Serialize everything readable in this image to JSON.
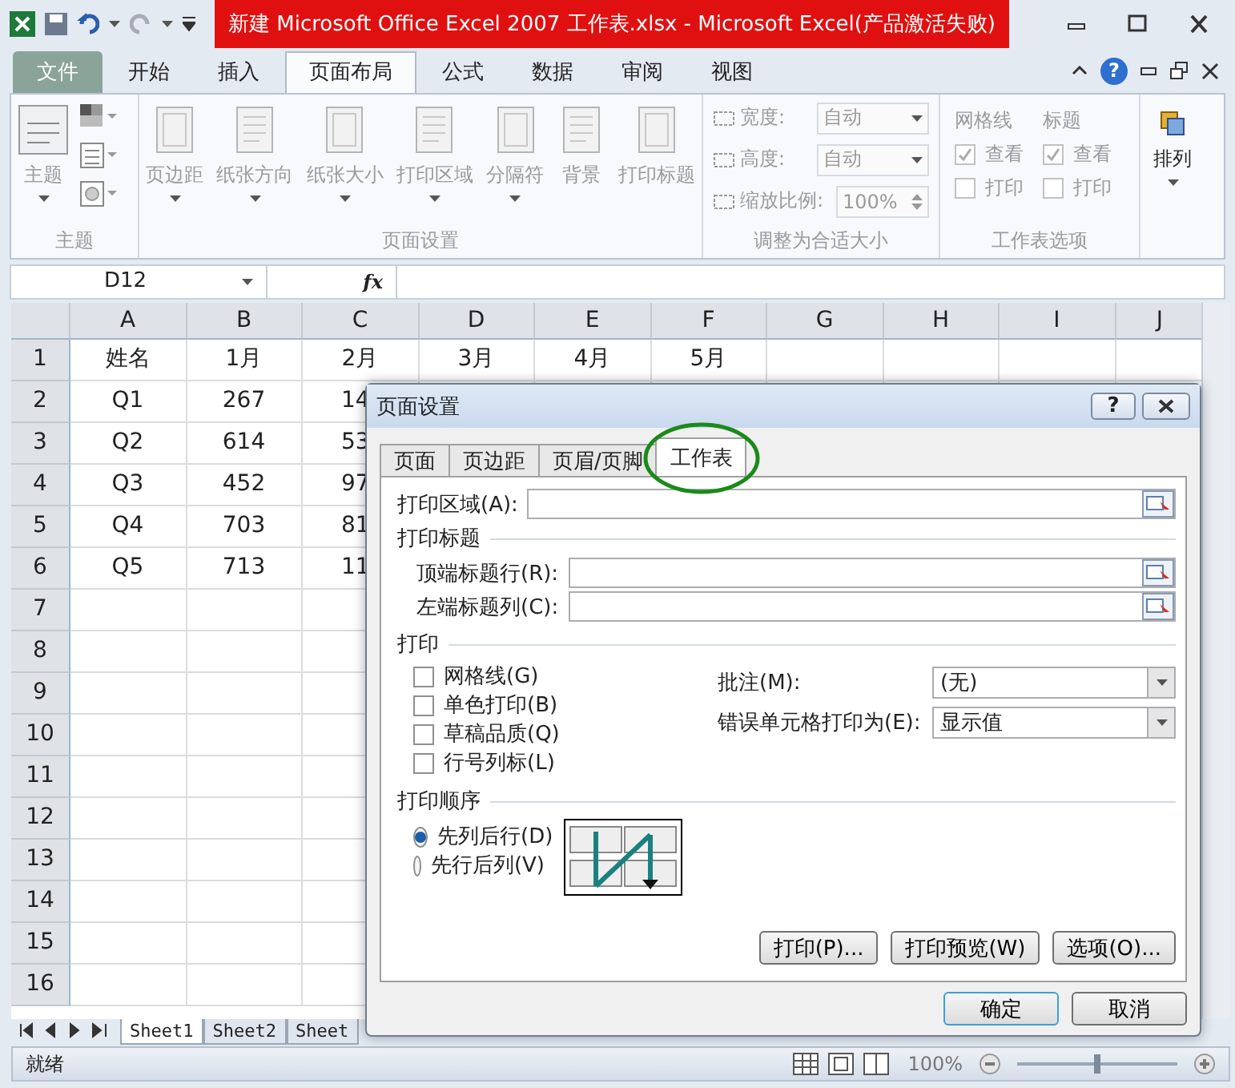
{
  "window": {
    "title": "新建 Microsoft Office Excel 2007 工作表.xlsx  -  Microsoft Excel(产品激活失败)"
  },
  "ribbon": {
    "disabled": true,
    "help_button": "?",
    "tabs": [
      {
        "label": "文件",
        "kind": "file",
        "selected": false
      },
      {
        "label": "开始",
        "kind": "tab",
        "selected": false
      },
      {
        "label": "插入",
        "kind": "tab",
        "selected": false
      },
      {
        "label": "页面布局",
        "kind": "tab",
        "selected": true
      },
      {
        "label": "公式",
        "kind": "tab",
        "selected": false
      },
      {
        "label": "数据",
        "kind": "tab",
        "selected": false
      },
      {
        "label": "审阅",
        "kind": "tab",
        "selected": false
      },
      {
        "label": "视图",
        "kind": "tab",
        "selected": false
      }
    ],
    "theme_group": {
      "label": "主题",
      "button": "主题"
    },
    "page_setup_group": {
      "label": "页面设置",
      "buttons": [
        "页边距",
        "纸张方向",
        "纸张大小",
        "打印区域",
        "分隔符",
        "背景",
        "打印标题"
      ]
    },
    "scale_group": {
      "label": "调整为合适大小",
      "fields": [
        {
          "label": "宽度:",
          "value": "自动",
          "kind": "dropdown"
        },
        {
          "label": "高度:",
          "value": "自动",
          "kind": "dropdown"
        },
        {
          "label": "缩放比例:",
          "value": "100%",
          "kind": "spin"
        }
      ]
    },
    "sheet_options_group": {
      "label": "工作表选项",
      "columns": [
        {
          "heading": "网格线",
          "options": [
            {
              "label": "查看",
              "checked": true
            },
            {
              "label": "打印",
              "checked": false
            }
          ]
        },
        {
          "heading": "标题",
          "options": [
            {
              "label": "查看",
              "checked": true
            },
            {
              "label": "打印",
              "checked": false
            }
          ]
        }
      ]
    },
    "arrange_group": {
      "button": "排列"
    }
  },
  "formula_bar": {
    "name_box": "D12",
    "function_button": "fx"
  },
  "sheet": {
    "columns": [
      "A",
      "B",
      "C",
      "D",
      "E",
      "F",
      "G",
      "H",
      "I",
      "J"
    ],
    "rows": [
      {
        "number": "1",
        "cells": [
          "姓名",
          "1月",
          "2月",
          "3月",
          "4月",
          "5月"
        ]
      },
      {
        "number": "2",
        "cells": [
          "Q1",
          "267",
          "14"
        ]
      },
      {
        "number": "3",
        "cells": [
          "Q2",
          "614",
          "53"
        ]
      },
      {
        "number": "4",
        "cells": [
          "Q3",
          "452",
          "97"
        ]
      },
      {
        "number": "5",
        "cells": [
          "Q4",
          "703",
          "81"
        ]
      },
      {
        "number": "6",
        "cells": [
          "Q5",
          "713",
          "11"
        ]
      },
      {
        "number": "7",
        "cells": []
      },
      {
        "number": "8",
        "cells": []
      },
      {
        "number": "9",
        "cells": []
      },
      {
        "number": "10",
        "cells": []
      },
      {
        "number": "11",
        "cells": []
      },
      {
        "number": "12",
        "cells": []
      },
      {
        "number": "13",
        "cells": []
      },
      {
        "number": "14",
        "cells": []
      },
      {
        "number": "15",
        "cells": []
      },
      {
        "number": "16",
        "cells": []
      }
    ]
  },
  "sheet_tabs": [
    {
      "label": "Sheet1",
      "selected": true
    },
    {
      "label": "Sheet2",
      "selected": false
    },
    {
      "label": "Sheet",
      "selected": false
    }
  ],
  "status_bar": {
    "status": "就绪",
    "zoom": {
      "reading": "100%",
      "level": 0.5
    }
  },
  "dialog": {
    "title": "页面设置",
    "help_button": "?",
    "tabs": [
      {
        "label": "页面",
        "selected": false
      },
      {
        "label": "页边距",
        "selected": false
      },
      {
        "label": "页眉/页脚",
        "selected": false
      },
      {
        "label": "工作表",
        "selected": true
      }
    ],
    "tab_annotation": {
      "color": "#1a8a1a"
    },
    "print_area": {
      "label": "打印区域(A):"
    },
    "print_titles": {
      "heading": "打印标题",
      "fields": [
        {
          "label": "顶端标题行(R):"
        },
        {
          "label": "左端标题列(C):"
        }
      ]
    },
    "print": {
      "heading": "打印",
      "checkboxes": [
        {
          "label": "网格线(G)",
          "checked": false
        },
        {
          "label": "单色打印(B)",
          "checked": false
        },
        {
          "label": "草稿品质(Q)",
          "checked": false
        },
        {
          "label": "行号列标(L)",
          "checked": false
        }
      ],
      "dropdowns": [
        {
          "label": "批注(M):",
          "value": "(无)"
        },
        {
          "label": "错误单元格打印为(E):",
          "value": "显示值"
        }
      ]
    },
    "page_order": {
      "heading": "打印顺序",
      "options": [
        {
          "label": "先列后行(D)",
          "selected": true
        },
        {
          "label": "先行后列(V)",
          "selected": false
        }
      ]
    },
    "action_buttons": [
      "打印(P)...",
      "打印预览(W)",
      "选项(O)..."
    ],
    "footer_buttons": [
      {
        "label": "确定",
        "kind": "default"
      },
      {
        "label": "取消",
        "kind": "normal"
      }
    ]
  }
}
